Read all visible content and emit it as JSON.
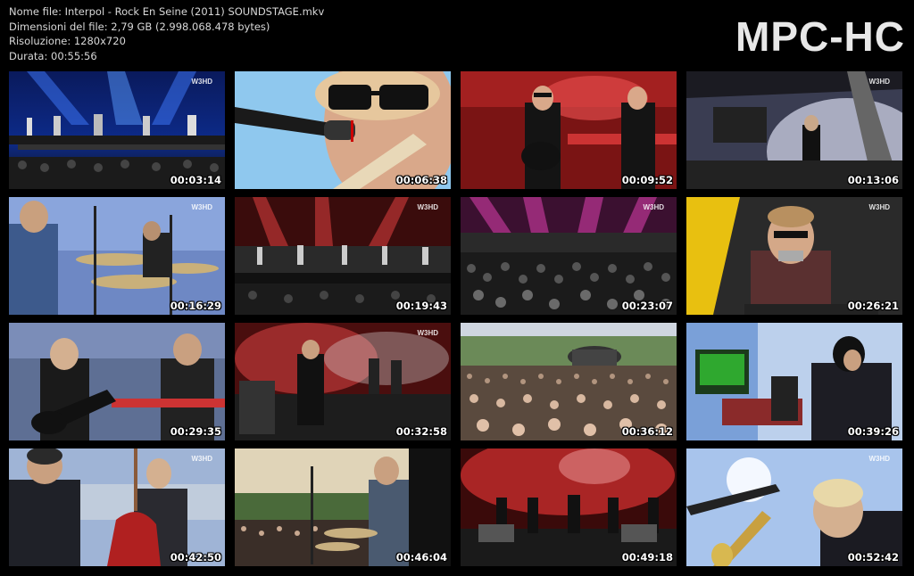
{
  "header": {
    "file_name": "Nome file: Interpol - Rock En Seine (2011) SOUNDSTAGE.mkv",
    "file_size": "Dimensioni del file: 2,79 GB (2.998.068.478 bytes)",
    "resolution": "Risoluzione: 1280x720",
    "duration": "Durata: 00:55:56",
    "logo": "MPC-HC"
  },
  "watermark": "W3HD",
  "thumbnails": [
    {
      "time": "00:03:14",
      "scene": "wide-stage-blue"
    },
    {
      "time": "00:06:38",
      "scene": "closeup-sunglasses-mic"
    },
    {
      "time": "00:09:52",
      "scene": "guitarist-red"
    },
    {
      "time": "00:13:06",
      "scene": "stage-side-white"
    },
    {
      "time": "00:16:29",
      "scene": "drummer-blue"
    },
    {
      "time": "00:19:43",
      "scene": "wide-stage-red"
    },
    {
      "time": "00:23:07",
      "scene": "crowd-pink-lights"
    },
    {
      "time": "00:26:21",
      "scene": "singer-harmonica-yellow"
    },
    {
      "time": "00:29:35",
      "scene": "band-keyboard"
    },
    {
      "time": "00:32:58",
      "scene": "stage-red-haze"
    },
    {
      "time": "00:36:12",
      "scene": "festival-crowd-day"
    },
    {
      "time": "00:39:26",
      "scene": "keyboard-player-green"
    },
    {
      "time": "00:42:50",
      "scene": "guitarist-red-guitar"
    },
    {
      "time": "00:46:04",
      "scene": "drummer-sunset"
    },
    {
      "time": "00:49:18",
      "scene": "wide-stage-red-smoke"
    },
    {
      "time": "00:52:42",
      "scene": "singer-guitar-light"
    }
  ]
}
